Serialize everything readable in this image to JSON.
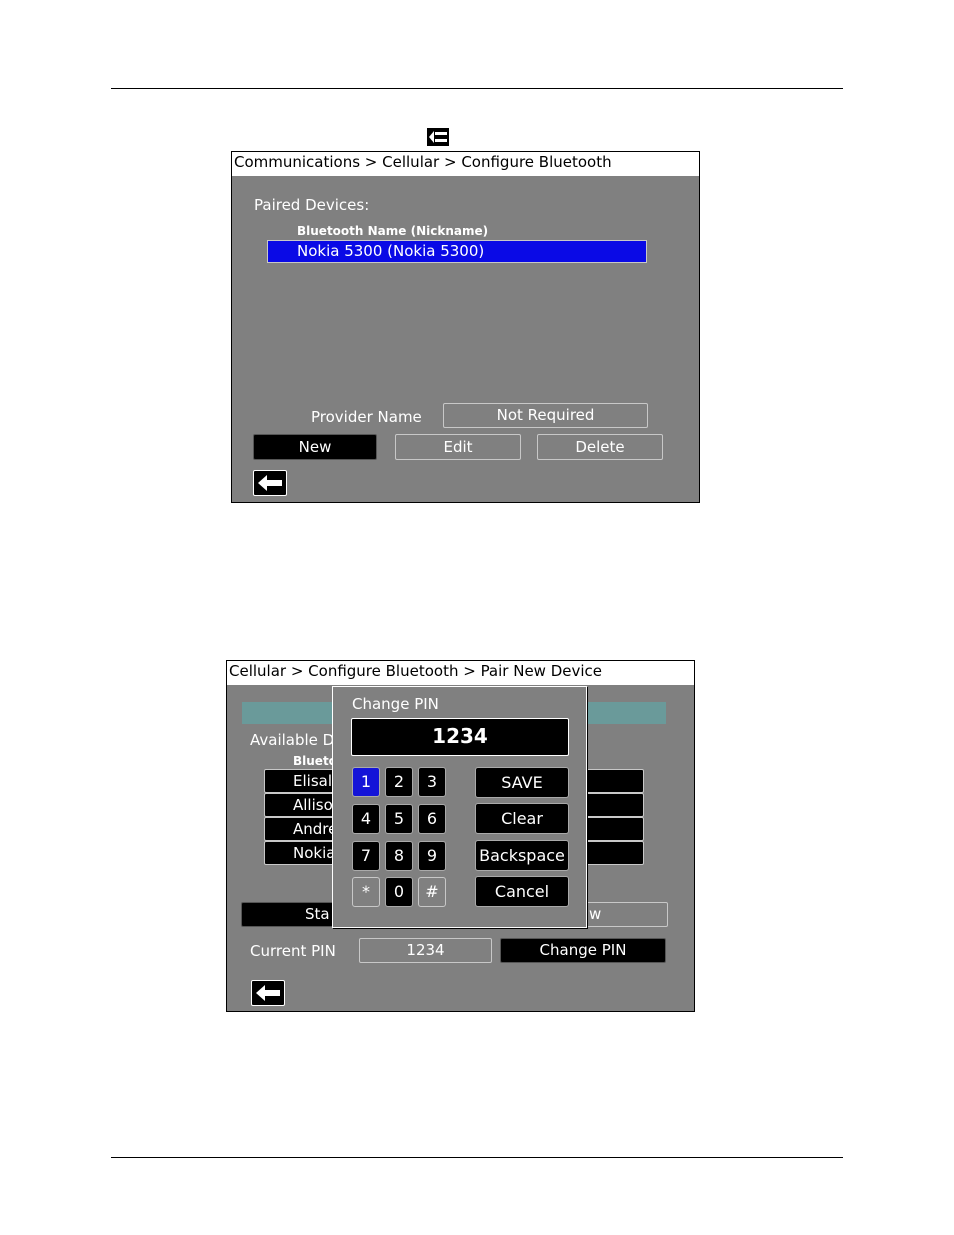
{
  "screen1": {
    "breadcrumb": "Communications > Cellular > Configure Bluetooth",
    "paired_label": "Paired Devices:",
    "column_header": "Bluetooth Name (Nickname)",
    "devices": [
      "Nokia 5300 (Nokia 5300)"
    ],
    "provider_label": "Provider Name",
    "provider_value": "Not Required",
    "buttons": {
      "new": "New",
      "edit": "Edit",
      "delete": "Delete"
    }
  },
  "screen2": {
    "breadcrumb": "Cellular > Configure Bluetooth > Pair New Device",
    "available_label": "Available D",
    "column_header": "Blueto",
    "devices": [
      "Elisal",
      "Alliso",
      "Andre",
      "Nokia"
    ],
    "start_button_partial": "Sta",
    "right_button_partial": "w",
    "current_pin_label": "Current PIN",
    "current_pin_value": "1234",
    "change_pin_button": "Change PIN",
    "dialog": {
      "title": "Change PIN",
      "pin": "1234",
      "keys": [
        "1",
        "2",
        "3",
        "4",
        "5",
        "6",
        "7",
        "8",
        "9",
        "*",
        "0",
        "#"
      ],
      "actions": {
        "save": "SAVE",
        "clear": "Clear",
        "backspace": "Backspace",
        "cancel": "Cancel"
      }
    }
  },
  "colors": {
    "screen_bg": "#808080",
    "selection": "#1414d8",
    "teal_bar": "#6a9a9a"
  }
}
